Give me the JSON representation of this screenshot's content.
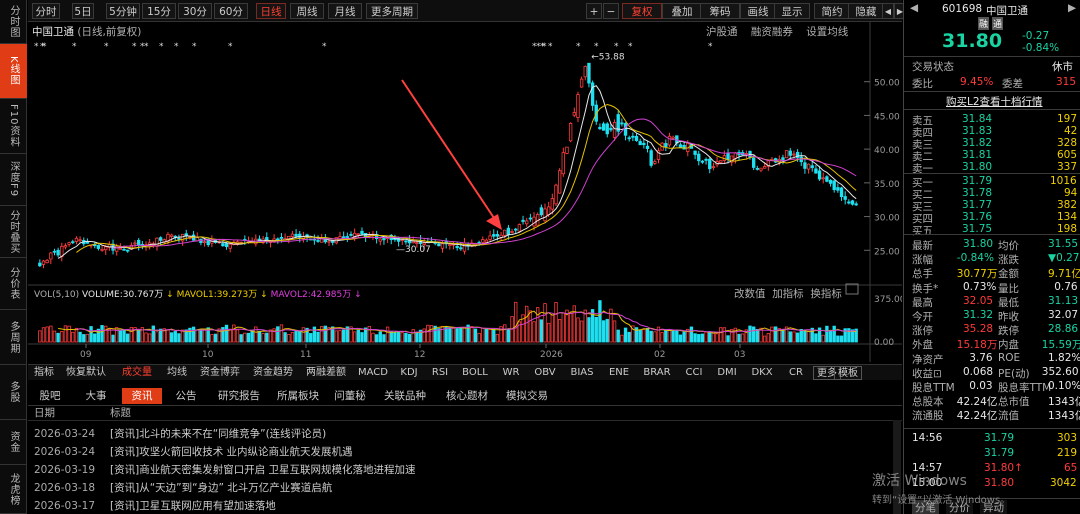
{
  "left_strip": [
    "分时图",
    "K线图",
    "F10资料",
    "深度F9",
    "分时叠买",
    "分价表",
    "多周期",
    "多股",
    "资金",
    "龙虎榜"
  ],
  "top_bar": {
    "tabs": [
      "分时",
      "5日",
      "5分钟",
      "15分钟",
      "30分钟",
      "60分钟",
      "日线",
      "周线",
      "月线",
      "更多周期"
    ],
    "active": "日线",
    "right": [
      "+",
      "−",
      "复权",
      "叠加",
      "筹码",
      "画线",
      "显示",
      "简约",
      "隐藏"
    ]
  },
  "chart_header": {
    "name": "中国卫通",
    "mode": "(日线,前复权)",
    "links": [
      "沪股通",
      "融资融券",
      "设置均线"
    ]
  },
  "chart_data": [
    {
      "type": "candlestick",
      "title": "中国卫通",
      "ylim": [
        20,
        55
      ],
      "yticks": [
        25.0,
        30.0,
        35.0,
        40.0,
        45.0,
        50.0
      ],
      "x_labels": [
        "09",
        "10",
        "11",
        "12",
        "2026",
        "02",
        "03"
      ],
      "annotations": [
        "53.88",
        "30.07"
      ],
      "up_color": "#ff3b3b",
      "down_color": "#1ee0f0"
    },
    {
      "type": "bar",
      "title": "VOL",
      "ylim": [
        0,
        400
      ],
      "yticks": [
        0.0,
        375.0
      ],
      "series": [
        {
          "name": "VOLUME",
          "value_label": "30.767万"
        },
        {
          "name": "MAVOL1",
          "value_label": "39.273万"
        },
        {
          "name": "MAVOL2",
          "value_label": "42.985万"
        }
      ]
    }
  ],
  "vol_header": {
    "label": "VOL(5,10)",
    "volume": "VOLUME:30.767万",
    "mavol1": "MAVOL1:39.273万",
    "mavol2": "MAVOL2:42.985万",
    "tools": [
      "改数值",
      "加指标",
      "换指标"
    ]
  },
  "indicator_tabs": [
    "指标",
    "恢复默认",
    "成交量",
    "均线",
    "资金博弈",
    "资金趋势",
    "两融差额",
    "MACD",
    "KDJ",
    "RSI",
    "BOLL",
    "WR",
    "OBV",
    "BIAS",
    "ENE",
    "BRAR",
    "CCI",
    "DMI",
    "DKX",
    "CR",
    "更多",
    "模板"
  ],
  "news_tabs": [
    "股吧",
    "大事",
    "资讯",
    "公告",
    "研究报告",
    "所属板块",
    "问董秘",
    "关联品种",
    "核心题材",
    "模拟交易"
  ],
  "news_active": "资讯",
  "news_header": {
    "date": "日期",
    "title": "标题"
  },
  "news": [
    {
      "date": "2026-03-24",
      "text": "[资讯]北斗的未来不在“同维竞争”(连线评论员)"
    },
    {
      "date": "2026-03-24",
      "text": "[资讯]攻坚火箭回收技术 业内纵论商业航天发展机遇"
    },
    {
      "date": "2026-03-19",
      "text": "[资讯]商业航天密集发射窗口开启 卫星互联网规模化落地进程加速"
    },
    {
      "date": "2026-03-18",
      "text": "[资讯]从“天边”到“身边” 北斗万亿产业赛道启航"
    },
    {
      "date": "2026-03-17",
      "text": "[资讯]卫星互联网应用有望加速落地"
    }
  ],
  "quote": {
    "code": "601698",
    "name": "中国卫通",
    "tags": [
      "融",
      "通"
    ],
    "price": "31.80",
    "change": "-0.27",
    "pct": "-0.84%",
    "trade_status_label": "交易状态",
    "trade_status": "休市",
    "weibi_label": "委比",
    "weibi": "9.45%",
    "weicha_label": "委差",
    "weicha": "315",
    "l2_link": "购买L2查看十档行情",
    "asks": [
      {
        "l": "卖五",
        "p": "31.84",
        "v": "197"
      },
      {
        "l": "卖四",
        "p": "31.83",
        "v": "42"
      },
      {
        "l": "卖三",
        "p": "31.82",
        "v": "328"
      },
      {
        "l": "卖二",
        "p": "31.81",
        "v": "605"
      },
      {
        "l": "卖一",
        "p": "31.80",
        "v": "337"
      }
    ],
    "bids": [
      {
        "l": "买一",
        "p": "31.79",
        "v": "1016"
      },
      {
        "l": "买二",
        "p": "31.78",
        "v": "94"
      },
      {
        "l": "买三",
        "p": "31.77",
        "v": "382"
      },
      {
        "l": "买四",
        "p": "31.76",
        "v": "134"
      },
      {
        "l": "买五",
        "p": "31.75",
        "v": "198"
      }
    ],
    "stats": [
      [
        "最新",
        "31.80",
        "均价",
        "31.55"
      ],
      [
        "涨幅",
        "-0.84%",
        "涨跌",
        "▼0.27"
      ],
      [
        "总手",
        "30.77万",
        "金额",
        "9.71亿"
      ],
      [
        "换手*",
        "0.73%",
        "量比",
        "0.76"
      ],
      [
        "最高",
        "32.05",
        "最低",
        "31.13"
      ],
      [
        "今开",
        "31.32",
        "昨收",
        "32.07"
      ],
      [
        "涨停",
        "35.28",
        "跌停",
        "28.86"
      ],
      [
        "外盘",
        "15.18万",
        "内盘",
        "15.59万"
      ],
      [
        "净资产",
        "3.76",
        "ROE",
        "1.82%"
      ],
      [
        "收益⊡",
        "0.068",
        "PE(动)",
        "352.60"
      ],
      [
        "股息TTM",
        "0.03",
        "股息率TTM",
        "0.10%"
      ],
      [
        "总股本",
        "42.24亿",
        "总市值",
        "1343亿"
      ],
      [
        "流通股",
        "42.24亿",
        "流值",
        "1343亿"
      ]
    ],
    "ticks": [
      {
        "t": "14:56",
        "p": "31.79",
        "v": "303"
      },
      {
        "t": "",
        "p": "31.79",
        "v": "219"
      },
      {
        "t": "14:57",
        "p": "31.80↑",
        "v": "65"
      },
      {
        "t": "15:00",
        "p": "31.80",
        "v": "3042"
      }
    ],
    "bottom_tabs": [
      "分笔",
      "分价",
      "异动"
    ]
  },
  "watermark": {
    "line1": "激活 Windows",
    "line2": "转到“设置”以激活 Windows。"
  }
}
